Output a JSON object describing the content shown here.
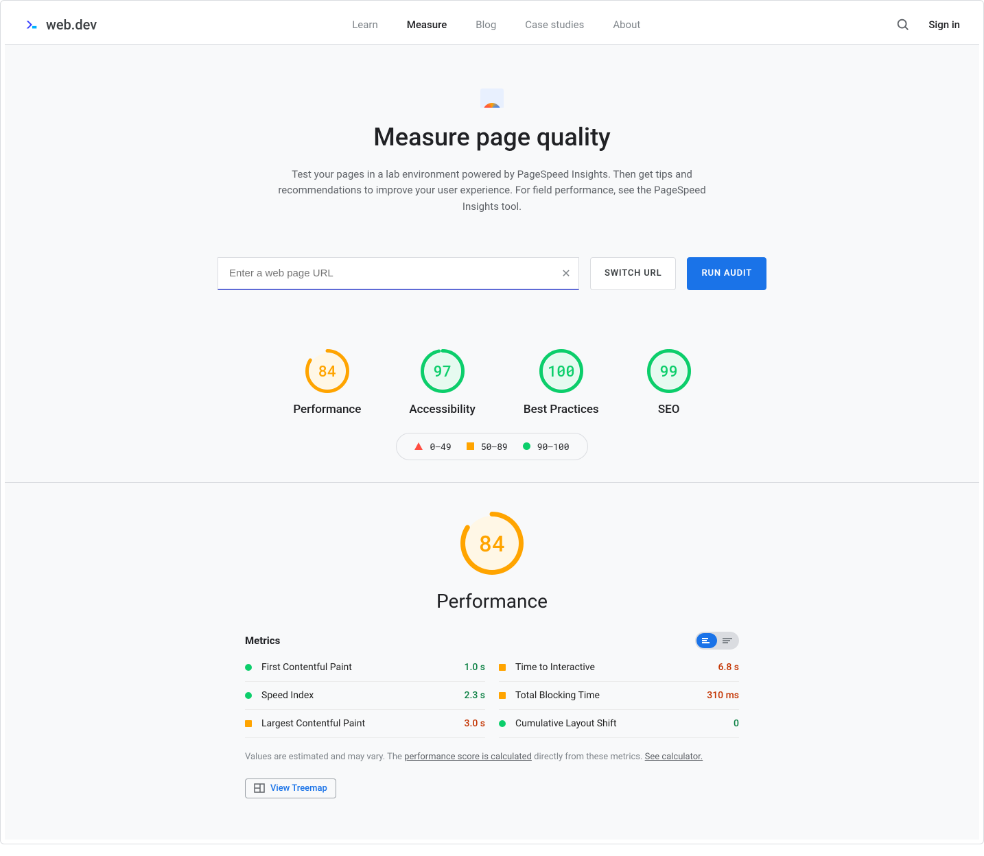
{
  "brand": "web.dev",
  "nav": {
    "learn": "Learn",
    "measure": "Measure",
    "blog": "Blog",
    "case_studies": "Case studies",
    "about": "About"
  },
  "signin": "Sign in",
  "hero": {
    "title": "Measure page quality",
    "subtitle": "Test your pages in a lab environment powered by PageSpeed Insights. Then get tips and recommendations to improve your user experience. For field performance, see the PageSpeed Insights tool."
  },
  "input": {
    "placeholder": "Enter a web page URL",
    "value": "",
    "switch": "SWITCH URL",
    "run": "RUN AUDIT"
  },
  "gauges": [
    {
      "label": "Performance",
      "score": 84,
      "color": "#ffa400",
      "bg": "#fff7e6"
    },
    {
      "label": "Accessibility",
      "score": 97,
      "color": "#0cce6b",
      "bg": "#e6faf0"
    },
    {
      "label": "Best Practices",
      "score": 100,
      "color": "#0cce6b",
      "bg": "#e6faf0"
    },
    {
      "label": "SEO",
      "score": 99,
      "color": "#0cce6b",
      "bg": "#e6faf0"
    }
  ],
  "legend": {
    "poor": "0–49",
    "med": "50–89",
    "good": "90–100"
  },
  "perf": {
    "title": "Performance",
    "score": 84,
    "color": "#ffa400",
    "bg": "#fff7e6",
    "metrics_heading": "Metrics"
  },
  "metrics": [
    {
      "name": "First Contentful Paint",
      "value": "1.0 s",
      "status": "good"
    },
    {
      "name": "Time to Interactive",
      "value": "6.8 s",
      "status": "avg-sq"
    },
    {
      "name": "Speed Index",
      "value": "2.3 s",
      "status": "good"
    },
    {
      "name": "Total Blocking Time",
      "value": "310 ms",
      "status": "avg-sq"
    },
    {
      "name": "Largest Contentful Paint",
      "value": "3.0 s",
      "status": "avg-sq"
    },
    {
      "name": "Cumulative Layout Shift",
      "value": "0",
      "status": "good"
    }
  ],
  "note": {
    "pre": "Values are estimated and may vary. The ",
    "link1": "performance score is calculated",
    "mid": " directly from these metrics. ",
    "link2": "See calculator."
  },
  "treemap": "View Treemap"
}
